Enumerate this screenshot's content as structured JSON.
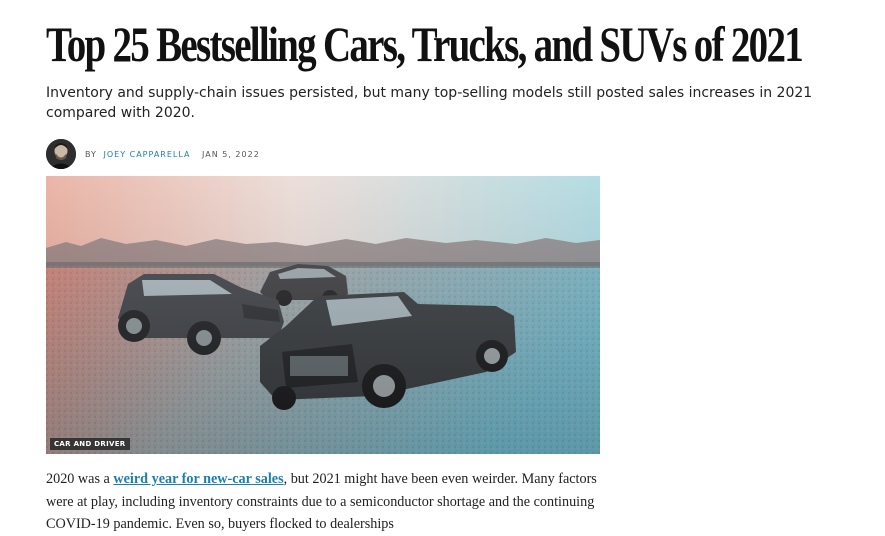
{
  "article": {
    "title": "Top 25 Bestselling Cars, Trucks, and SUVs of 2021",
    "dek": "Inventory and supply-chain issues persisted, but many top-selling models still posted sales increases in 2021 compared with 2020.",
    "byline_prefix": "BY",
    "author": "JOEY CAPPARELLA",
    "date": "JAN 5, 2022",
    "image_credit": "CAR AND DRIVER",
    "body": {
      "text_before_link": "2020 was a ",
      "link_text": "weird year for new-car sales",
      "text_after_link": ", but 2021 might have been even weirder. Many factors were at play, including inventory constraints due to a semiconductor shortage and the continuing COVID-19 pandemic. Even so, buyers flocked to dealerships"
    }
  },
  "icons": {
    "avatar": "author-portrait"
  },
  "colors": {
    "link": "#1c7fae",
    "hero_warm": "#d98f7e",
    "hero_cool": "#7fc0cf"
  }
}
